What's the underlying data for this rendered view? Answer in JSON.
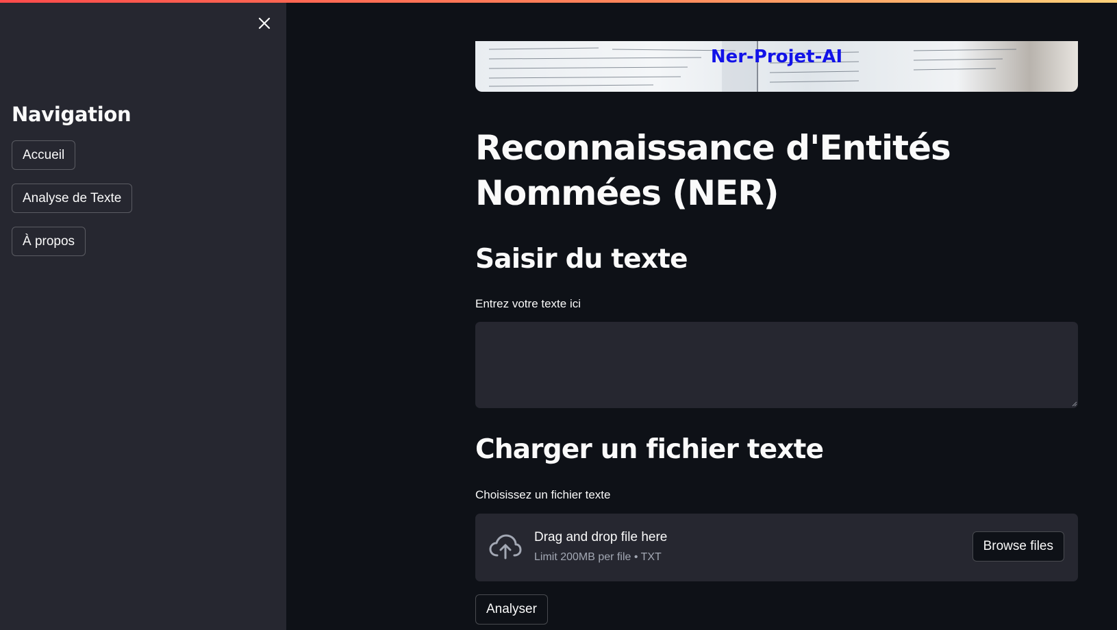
{
  "sidebar": {
    "close_icon": "close-icon",
    "title": "Navigation",
    "items": [
      {
        "label": "Accueil"
      },
      {
        "label": "Analyse de Texte"
      },
      {
        "label": "À propos"
      }
    ]
  },
  "banner": {
    "title": "Ner-Projet-AI"
  },
  "main": {
    "title": "Reconnaissance d'Entités Nommées (NER)",
    "text_section": {
      "heading": "Saisir du texte",
      "label": "Entrez votre texte ici",
      "value": ""
    },
    "file_section": {
      "heading": "Charger un fichier texte",
      "label": "Choisissez un fichier texte",
      "drop_text": "Drag and drop file here",
      "limit_text": "Limit 200MB per file • TXT",
      "browse_label": "Browse files",
      "upload_icon": "cloud-upload-icon"
    },
    "analyze_label": "Analyser"
  },
  "colors": {
    "background": "#0e1117",
    "sidebar": "#262730",
    "input_bg": "#262730",
    "accent_start": "#ff4b4b",
    "accent_end": "#ffd27a",
    "banner_text": "#1212e8"
  }
}
